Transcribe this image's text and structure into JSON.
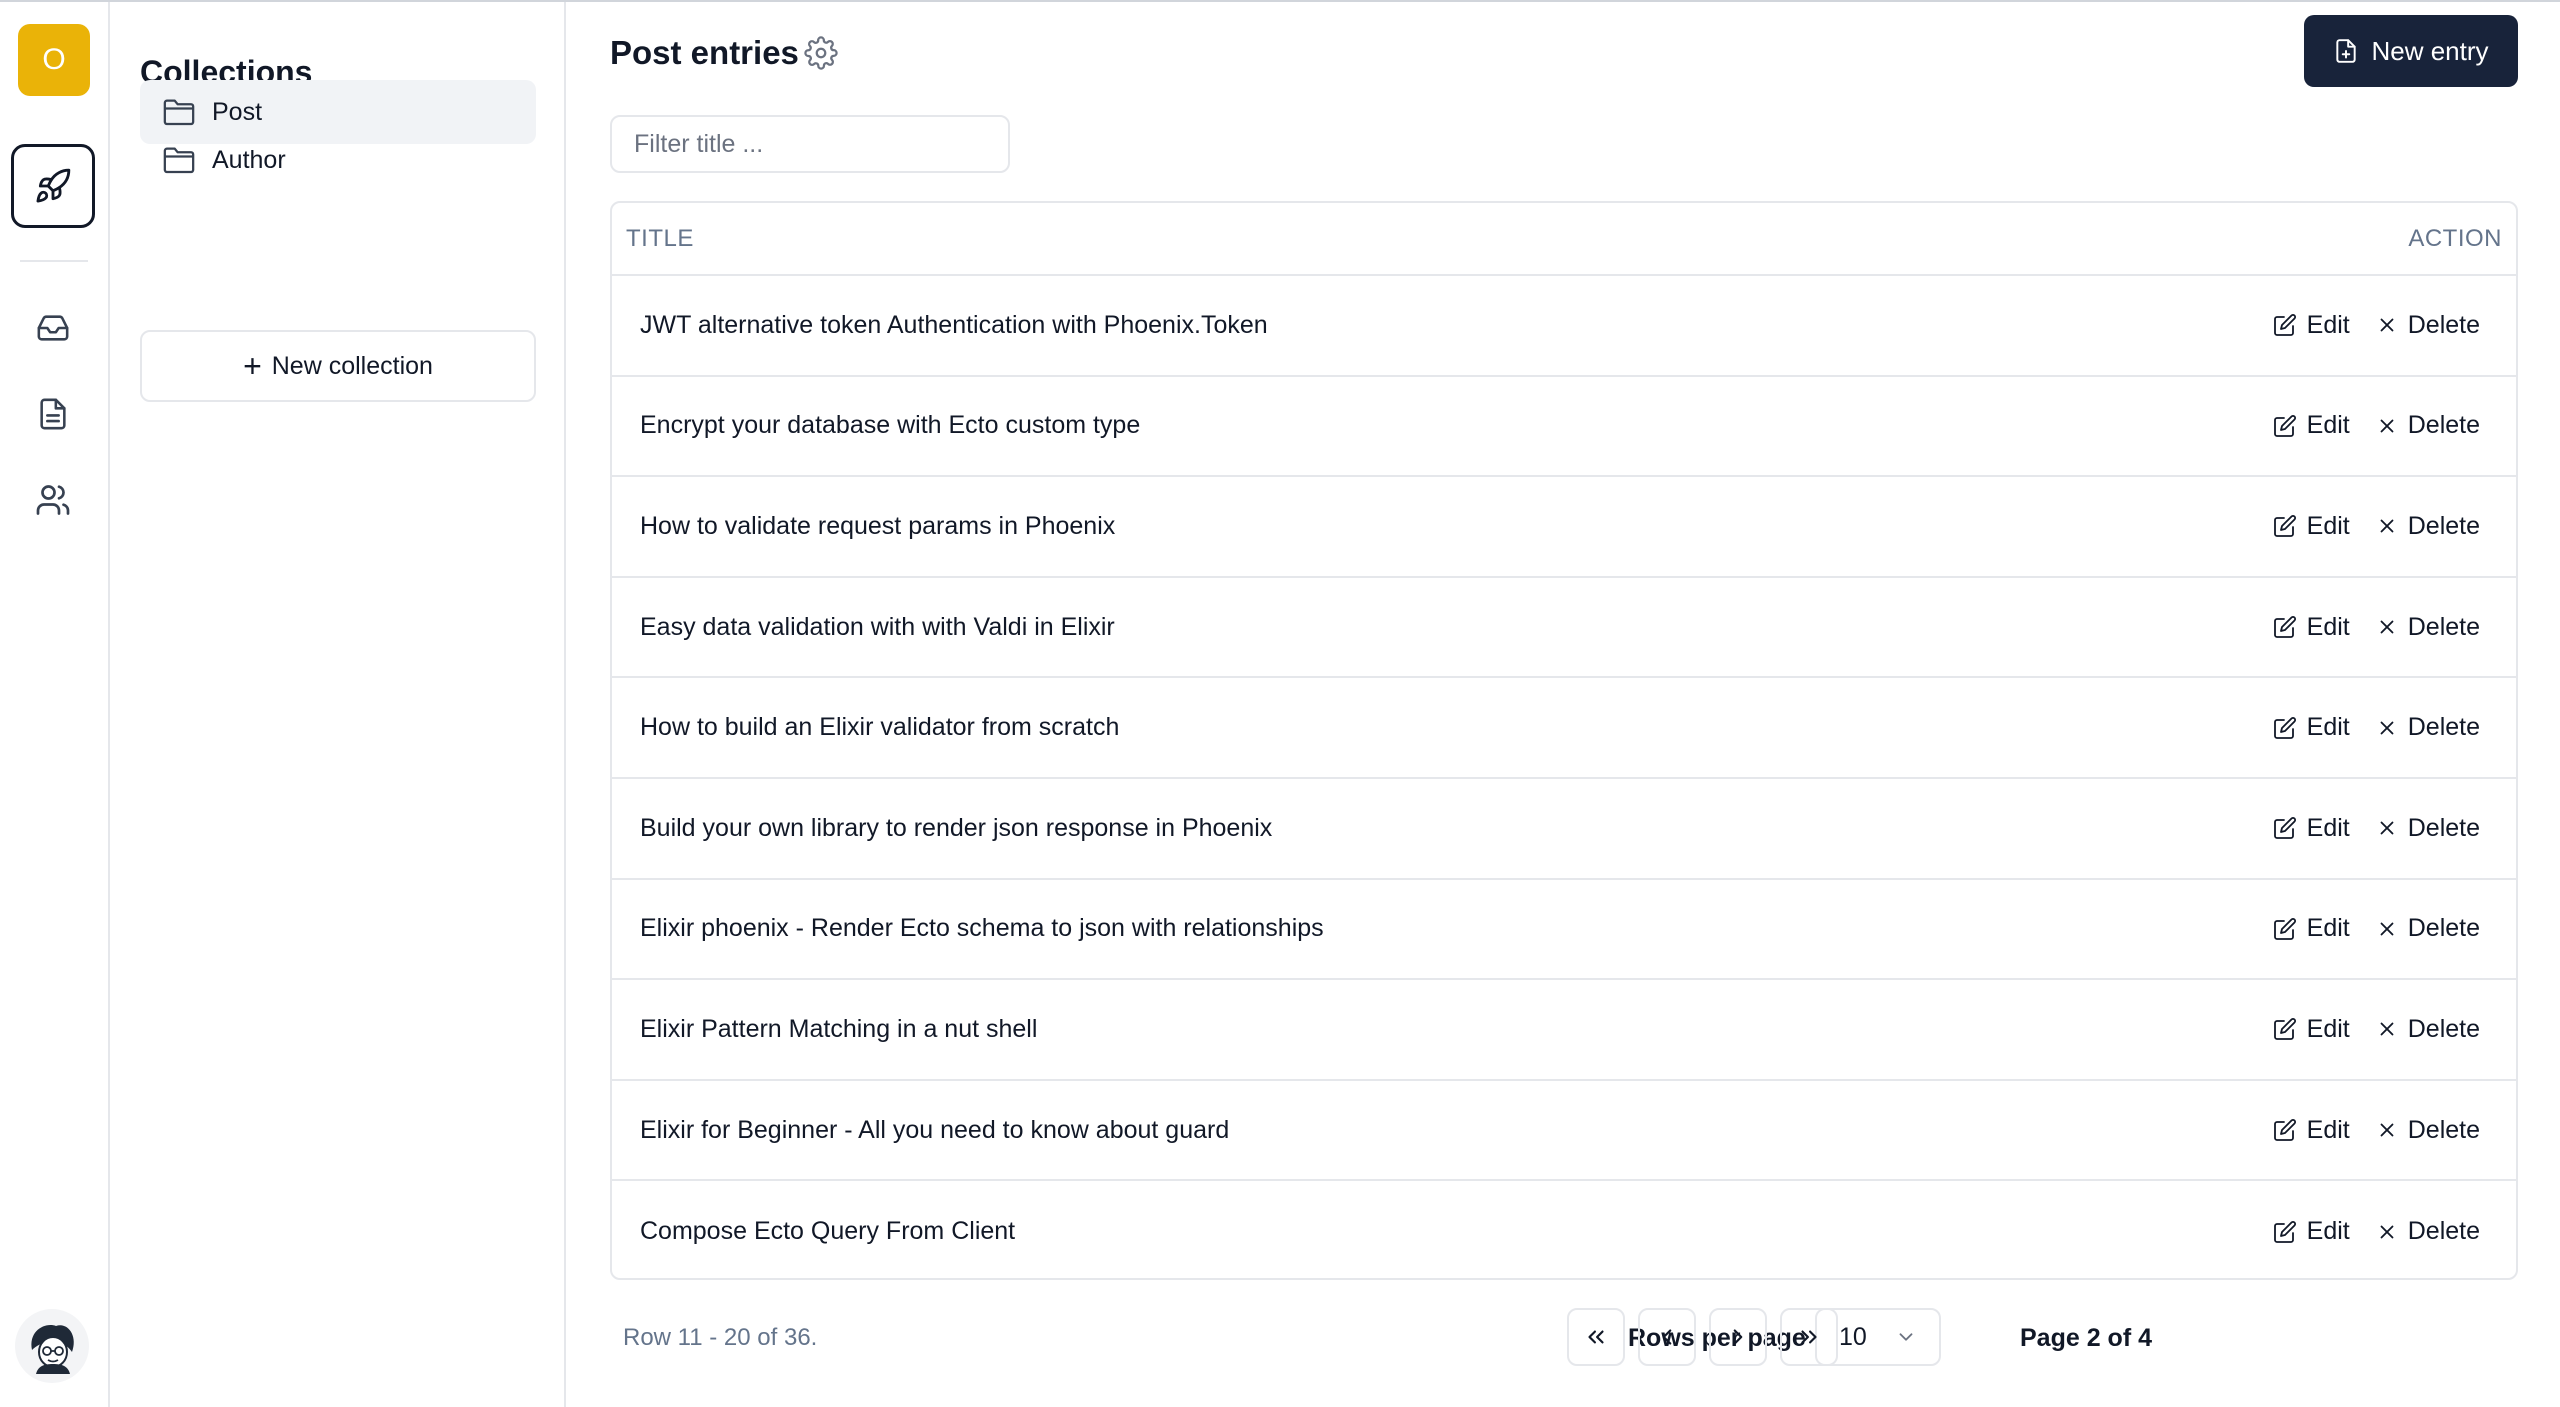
{
  "rail": {
    "org_initial": "O",
    "items": [
      {
        "icon": "rocket-icon",
        "active": true
      },
      {
        "icon": "inbox-icon"
      },
      {
        "icon": "document-icon"
      },
      {
        "icon": "users-icon"
      }
    ],
    "avatar_icon": "user-avatar"
  },
  "collections": {
    "title": "Collections",
    "items": [
      {
        "label": "Post",
        "icon": "folder-icon",
        "active": true
      },
      {
        "label": "Author",
        "icon": "folder-icon",
        "active": false
      }
    ],
    "new_button": "New collection"
  },
  "main": {
    "title": "Post entries",
    "new_entry_button": "New entry",
    "filter_placeholder": "Filter title ...",
    "table": {
      "headers": {
        "title": "TITLE",
        "action": "ACTION"
      },
      "edit_label": "Edit",
      "delete_label": "Delete",
      "rows": [
        "JWT alternative token Authentication with Phoenix.Token",
        "Encrypt your database with Ecto custom type",
        "How to validate request params in Phoenix",
        "Easy data validation with with Valdi in Elixir",
        "How to build an Elixir validator from scratch",
        "Build your own library to render json response in Phoenix",
        "Elixir phoenix - Render Ecto schema to json with relationships",
        "Elixir Pattern Matching in a nut shell",
        "Elixir for Beginner - All you need to know about guard",
        "Compose Ecto Query From Client"
      ]
    },
    "footer": {
      "summary": "Row 11 - 20 of 36.",
      "rows_per_page_label": "Rows per page",
      "rows_per_page_value": "10",
      "page_info": "Page 2 of 4"
    }
  },
  "colors": {
    "accent_dark": "#18233a",
    "org_badge": "#eab308",
    "active_bg": "#f1f3f6",
    "muted_text": "#64748b"
  }
}
